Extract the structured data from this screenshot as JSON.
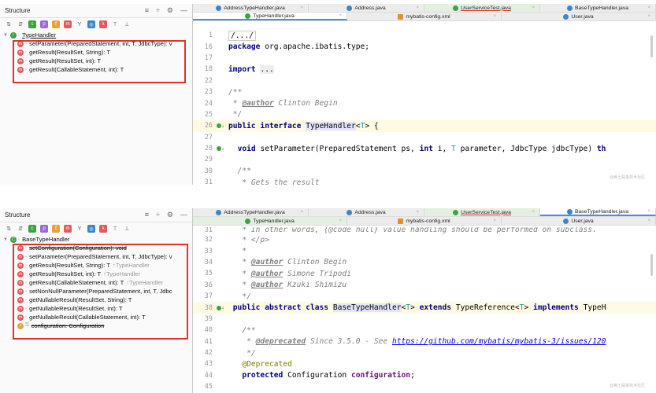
{
  "panel1": {
    "structure": {
      "title": "Structure",
      "root": "TypeHandler",
      "items": [
        "setParameter(PreparedStatement, int, T, JdbcType): v",
        "getResult(ResultSet, String): T",
        "getResult(ResultSet, int): T",
        "getResult(CallableStatement, int): T"
      ]
    },
    "tabs_row1": [
      "AddressTypeHandler.java",
      "Address.java",
      "UserServiceTest.java",
      "BaseTypeHandler.java"
    ],
    "tabs_row2": [
      "TypeHandler.java",
      "mybatis-config.xml",
      "User.java"
    ],
    "lines": [
      {
        "n": "1",
        "t": "/.../"
      },
      {
        "n": "16",
        "t": "package org.apache.ibatis.type;"
      },
      {
        "n": "17",
        "t": ""
      },
      {
        "n": "18",
        "t": "import ..."
      },
      {
        "n": "22",
        "t": ""
      },
      {
        "n": "23",
        "t": "/**"
      },
      {
        "n": "24",
        "t": " * @author Clinton Begin"
      },
      {
        "n": "25",
        "t": " */"
      },
      {
        "n": "26",
        "t": "public interface TypeHandler<T> {"
      },
      {
        "n": "27",
        "t": ""
      },
      {
        "n": "28",
        "t": "  void setParameter(PreparedStatement ps, int i, T parameter, JdbcType jdbcType) th"
      },
      {
        "n": "29",
        "t": ""
      },
      {
        "n": "30",
        "t": "  /**"
      },
      {
        "n": "31",
        "t": "   * Gets the result"
      }
    ],
    "watermark": "@稀土掘金技术社区"
  },
  "panel2": {
    "structure": {
      "title": "Structure",
      "root": "BaseTypeHandler",
      "items": [
        {
          "text": "setConfiguration(Configuration): void",
          "strike": true,
          "hint": ""
        },
        {
          "text": "setParameter(PreparedStatement, int, T, JdbcType): v",
          "strike": false,
          "hint": ""
        },
        {
          "text": "getResult(ResultSet, String): T",
          "strike": false,
          "hint": "↑TypeHandler"
        },
        {
          "text": "getResult(ResultSet, int): T",
          "strike": false,
          "hint": "↑TypeHandler"
        },
        {
          "text": "getResult(CallableStatement, int): T",
          "strike": false,
          "hint": "↑TypeHandler"
        },
        {
          "text": "setNonNullParameter(PreparedStatement, int, T, Jdbc",
          "strike": false,
          "hint": ""
        },
        {
          "text": "getNullableResult(ResultSet, String): T",
          "strike": false,
          "hint": ""
        },
        {
          "text": "getNullableResult(ResultSet, int): T",
          "strike": false,
          "hint": ""
        },
        {
          "text": "getNullableResult(CallableStatement, int): T",
          "strike": false,
          "hint": ""
        },
        {
          "text": "configuration: Configuration",
          "strike": true,
          "hint": ""
        }
      ]
    },
    "tabs_row1": [
      "AddressTypeHandler.java",
      "Address.java",
      "UserServiceTest.java",
      "BaseTypeHandler.java"
    ],
    "tabs_row2": [
      "TypeHandler.java",
      "mybatis-config.xml",
      "User.java"
    ],
    "lines": [
      {
        "n": "31",
        "t": "   * In other words, {@code null} value handling should be performed on subclass."
      },
      {
        "n": "32",
        "t": "   * </p>"
      },
      {
        "n": "33",
        "t": "   *"
      },
      {
        "n": "34",
        "t": "   * @author Clinton Begin"
      },
      {
        "n": "35",
        "t": "   * @author Simone Tripodi"
      },
      {
        "n": "36",
        "t": "   * @author Kzuki Shimizu"
      },
      {
        "n": "37",
        "t": "   */"
      },
      {
        "n": "38",
        "t": " public abstract class BaseTypeHandler<T> extends TypeReference<T> implements TypeH"
      },
      {
        "n": "39",
        "t": ""
      },
      {
        "n": "40",
        "t": "   /**"
      },
      {
        "n": "41",
        "t": "    * @deprecated Since 3.5.0 - See https://github.com/mybatis/mybatis-3/issues/120"
      },
      {
        "n": "42",
        "t": "    */"
      },
      {
        "n": "43",
        "t": "   @Deprecated"
      },
      {
        "n": "44",
        "t": "   protected Configuration configuration;"
      },
      {
        "n": "45",
        "t": ""
      }
    ],
    "watermark": "@稀土掘金技术社区"
  },
  "colors": {
    "highlight_box": "#e2322b",
    "keyword": "#000080",
    "comment": "#808080"
  }
}
